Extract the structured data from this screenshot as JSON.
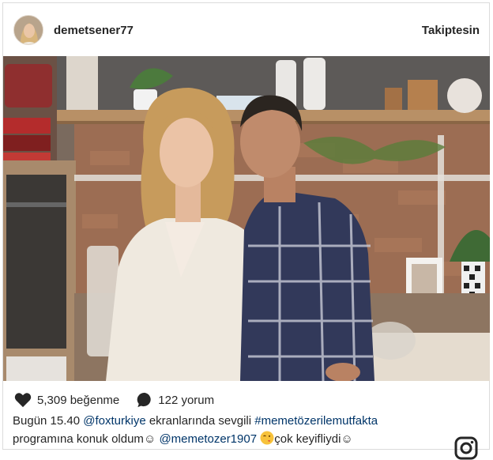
{
  "post": {
    "username": "demetsener77",
    "follow_label": "Takiptesin",
    "likes": "5,309 beğenme",
    "comments": "122 yorum"
  },
  "caption": {
    "part1": "Bugün 15.40 ",
    "mention1": "@foxturkiye",
    "part2": " ekranlarında sevgili ",
    "hashtag": "#memetözerilemutfakta",
    "part3": "programına konuk oldum",
    "smile1": "☺",
    "mention2": "@memetozer1907",
    "part4": "çok keyifliydi",
    "smile2": "☺"
  },
  "colors": {
    "text": "#262626",
    "link": "#003569",
    "border": "#dbdbdb"
  },
  "icons": [
    "heart-icon",
    "comment-icon",
    "wink-emoji-icon",
    "instagram-icon"
  ]
}
